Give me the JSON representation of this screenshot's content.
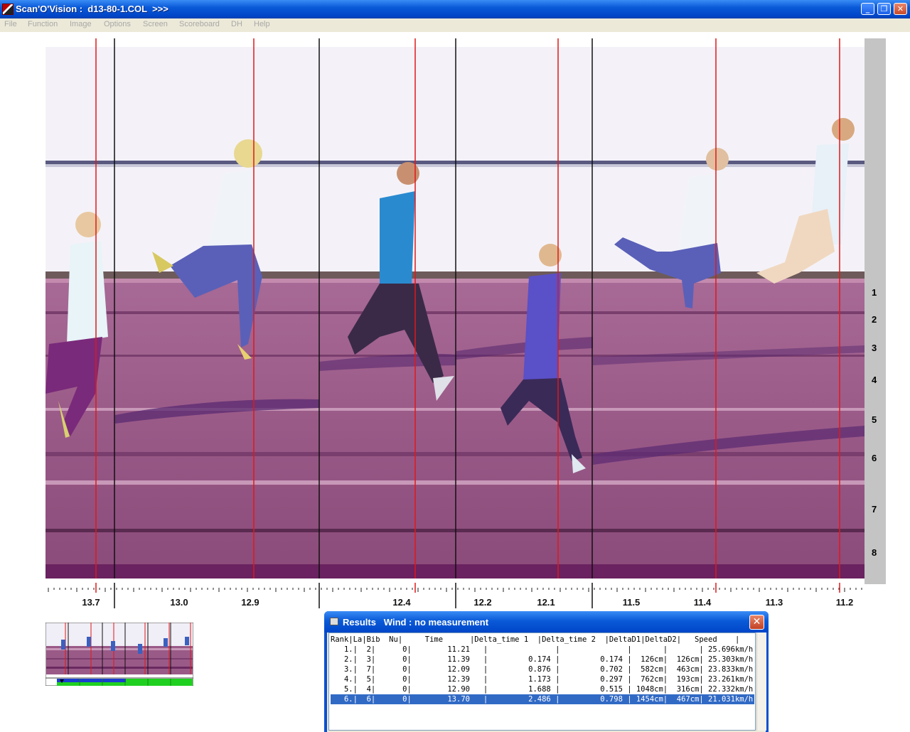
{
  "window": {
    "title": "Scan'O'Vision :  d13-80-1.COL  >>>",
    "minimize_glyph": "_",
    "restore_glyph": "❐",
    "close_glyph": "✕"
  },
  "menu": [
    "File",
    "Function",
    "Image",
    "Options",
    "Screen",
    "Scoreboard",
    "DH",
    "Help"
  ],
  "lanes": [
    "1",
    "2",
    "3",
    "4",
    "5",
    "6",
    "7",
    "8"
  ],
  "time_ticks": [
    "13.7",
    "13.0",
    "12.9",
    "12.4",
    "12.2",
    "12.1",
    "11.5",
    "11.4",
    "11.3",
    "11.2"
  ],
  "results": {
    "title": "Results   Wind : no measurement",
    "header": "Rank|La|Bib  Nu|     Time      |Delta_time 1  |Delta_time 2  |DeltaD1|DeltaD2|   Speed    |",
    "rows": [
      "   1.|  2|      0|        11.21   |               |               |       |       | 25.696km/h|",
      "   2.|  3|      0|        11.39   |         0.174 |         0.174 |  126cm|  126cm| 25.303km/h|",
      "   3.|  7|      0|        12.09   |         0.876 |         0.702 |  582cm|  463cm| 23.833km/h|",
      "   4.|  5|      0|        12.39   |         1.173 |         0.297 |  762cm|  193cm| 23.261km/h|",
      "   5.|  4|      0|        12.90   |         1.688 |         0.515 | 1048cm|  316cm| 22.332km/h|",
      "   6.|  6|      0|        13.70   |         2.486 |         0.798 | 1454cm|  467cm| 21.031km/h|"
    ],
    "selected_row": 6,
    "close_glyph": "✕"
  },
  "colors": {
    "track": "#9a5a88",
    "sky": "#f4f2f8",
    "red_line": "#e01818",
    "black_line": "#101010",
    "accent": "#0a5ad8",
    "selection": "#316ac5"
  },
  "icons": [
    "app-icon",
    "minimize-icon",
    "restore-icon",
    "close-icon",
    "results-icon",
    "results-close-icon"
  ]
}
